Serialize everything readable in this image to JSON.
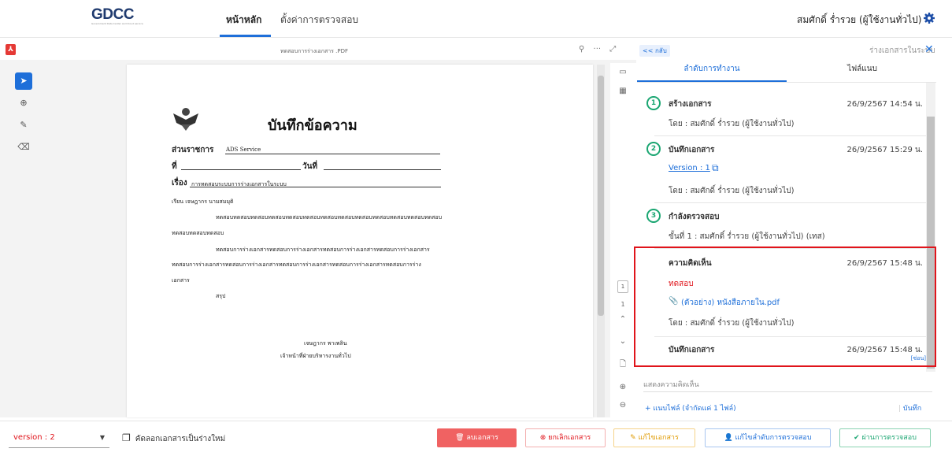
{
  "header": {
    "logo_text": "GDCC",
    "logo_sub": "Government Data Center and Cloud service",
    "nav": {
      "home": "หน้าหลัก",
      "settings": "ตั้งค่าการตรวจสอบ"
    },
    "user": "สมศักดิ์ ร่ำรวย (ผู้ใช้งานทั่วไป)"
  },
  "viewer": {
    "filename": "ทดสอบการร่างเอกสาร .PDF",
    "page_number": "1",
    "page_indicator": "1"
  },
  "document": {
    "title": "บันทึกข้อความ",
    "dept_label": "ส่วนราชการ",
    "dept_value": "ADS Service",
    "no_label": "ที่",
    "date_label": "วันที่",
    "subject_label": "เรื่อง",
    "subject_value": "การทดสอบระบบการร่างเอกสารในระบบ",
    "to_line": "เรียน  เจษฎากร นามสมมุติ",
    "para1_a": "ทดสอบทดสอบทดสอบทดสอบทดสอบทดสอบทดสอบทดสอบทดสอบทดสอบทดสอบทดสอบทดสอบ",
    "para1_b": "ทดสอบทดสอบทดสอบ",
    "para2_a": "ทดสอบการร่างเอกสารทดสอบการร่างเอกสารทดสอบการร่างเอกสารทดสอบการร่างเอกสาร",
    "para2_b": "ทดสอบการร่างเอกสารทดสอบการร่างเอกสารทดสอบการร่างเอกสารทดสอบการร่างเอกสารทดสอบการร่าง",
    "para2_c": "เอกสาร",
    "summary": "สรุป",
    "sign_name": "เจษฎากร พาเพลิน",
    "sign_position": "เจ้าหน้าที่ฝ่ายบริหารงานทั่วไป"
  },
  "panel": {
    "back": "<< กลับ",
    "title": "ร่างเอกสารในระบบ",
    "tabs": {
      "workflow": "ลำดับการทำงาน",
      "files": "ไฟล์แนบ"
    },
    "steps": [
      {
        "num": "1",
        "title": "สร้างเอกสาร",
        "date": "26/9/2567 14:54 น.",
        "by": "โดย : สมศักดิ์ ร่ำรวย (ผู้ใช้งานทั่วไป)"
      },
      {
        "num": "2",
        "title": "บันทึกเอกสาร",
        "date": "26/9/2567 15:29 น.",
        "version": "Version : 1",
        "by": "โดย : สมศักดิ์ ร่ำรวย (ผู้ใช้งานทั่วไป)"
      },
      {
        "num": "3",
        "title": "กำลังตรวจสอบ",
        "detail": "ขั้นที่ 1 : สมศักดิ์ ร่ำรวย (ผู้ใช้งานทั่วไป) (เทส)"
      }
    ],
    "comment": {
      "title": "ความคิดเห็น",
      "date": "26/9/2567 15:48 น.",
      "text": "ทดสอบ",
      "file": "(ตัวอย่าง) หนังสือภายใน.pdf",
      "by": "โดย : สมศักดิ์ ร่ำรวย (ผู้ใช้งานทั่วไป)"
    },
    "save_entry": {
      "title": "บันทึกเอกสาร",
      "date": "26/9/2567 15:48 น.",
      "tag": "[ซ่อน]"
    },
    "comment_placeholder": "แสดงความคิดเห็น",
    "attach_label": "+  แนบไฟล์ (จำกัดแค่ 1 ไฟล์)",
    "save_label": "บันทึก"
  },
  "footer": {
    "version": "version : 2",
    "copy": "คัดลอกเอกสารเป็นร่างใหม่",
    "delete": "ลบเอกสาร",
    "cancel": "ยกเลิกเอกสาร",
    "edit": "แก้ไขเอกสาร",
    "edit_flow": "แก้ไขลำดับการตรวจสอบ",
    "approve": "ผ่านการตรวจสอบ"
  },
  "colors": {
    "accent": "#1e6fd9",
    "danger": "#e0141b",
    "success": "#1ba672",
    "warning": "#e09a00"
  }
}
